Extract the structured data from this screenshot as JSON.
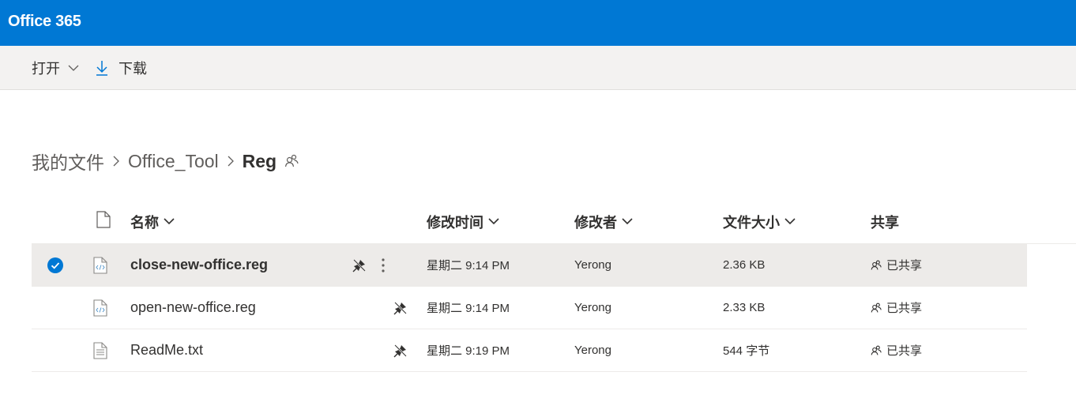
{
  "app": {
    "title": "Office 365",
    "brand_color": "#0078d4"
  },
  "commands": {
    "open_label": "打开",
    "download_label": "下载"
  },
  "breadcrumb": {
    "items": [
      "我的文件",
      "Office_Tool"
    ],
    "current": "Reg"
  },
  "columns": {
    "name": "名称",
    "modified": "修改时间",
    "modified_by": "修改者",
    "size": "文件大小",
    "sharing": "共享"
  },
  "files": [
    {
      "name": "close-new-office.reg",
      "modified": "星期二 9:14 PM",
      "modified_by": "Yerong",
      "size": "2.36 KB",
      "sharing": "已共享",
      "icon": "code-file-icon",
      "selected": true
    },
    {
      "name": "open-new-office.reg",
      "modified": "星期二 9:14 PM",
      "modified_by": "Yerong",
      "size": "2.33 KB",
      "sharing": "已共享",
      "icon": "code-file-icon",
      "selected": false
    },
    {
      "name": "ReadMe.txt",
      "modified": "星期二 9:19 PM",
      "modified_by": "Yerong",
      "size": "544 字节",
      "sharing": "已共享",
      "icon": "text-file-icon",
      "selected": false
    }
  ]
}
